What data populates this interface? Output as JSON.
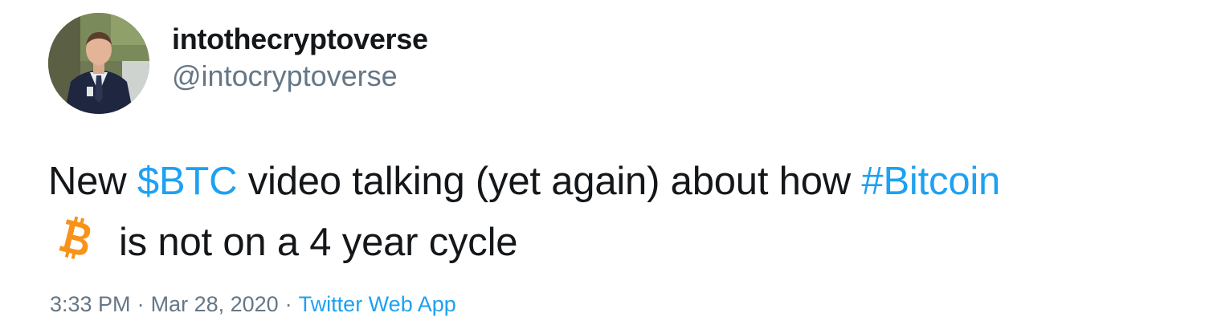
{
  "author": {
    "display_name": "intothecryptoverse",
    "handle": "@intocryptoverse",
    "avatar": "profile-photo"
  },
  "tweet": {
    "line1": [
      {
        "text": "New ",
        "type": "text"
      },
      {
        "text": "$BTC",
        "type": "cashtag"
      },
      {
        "text": " video talking (yet again) about how ",
        "type": "text"
      },
      {
        "text": "#Bitcoin",
        "type": "hashtag"
      }
    ],
    "emoji": "bitcoin-icon",
    "line2_text": "is not on a 4 year cycle"
  },
  "meta": {
    "time": "3:33 PM",
    "separator": "·",
    "date": "Mar 28, 2020",
    "source": "Twitter Web App"
  },
  "colors": {
    "link": "#1da1f2",
    "secondary_text": "#657786",
    "primary_text": "#14171a",
    "bitcoin_orange": "#f7931a"
  }
}
